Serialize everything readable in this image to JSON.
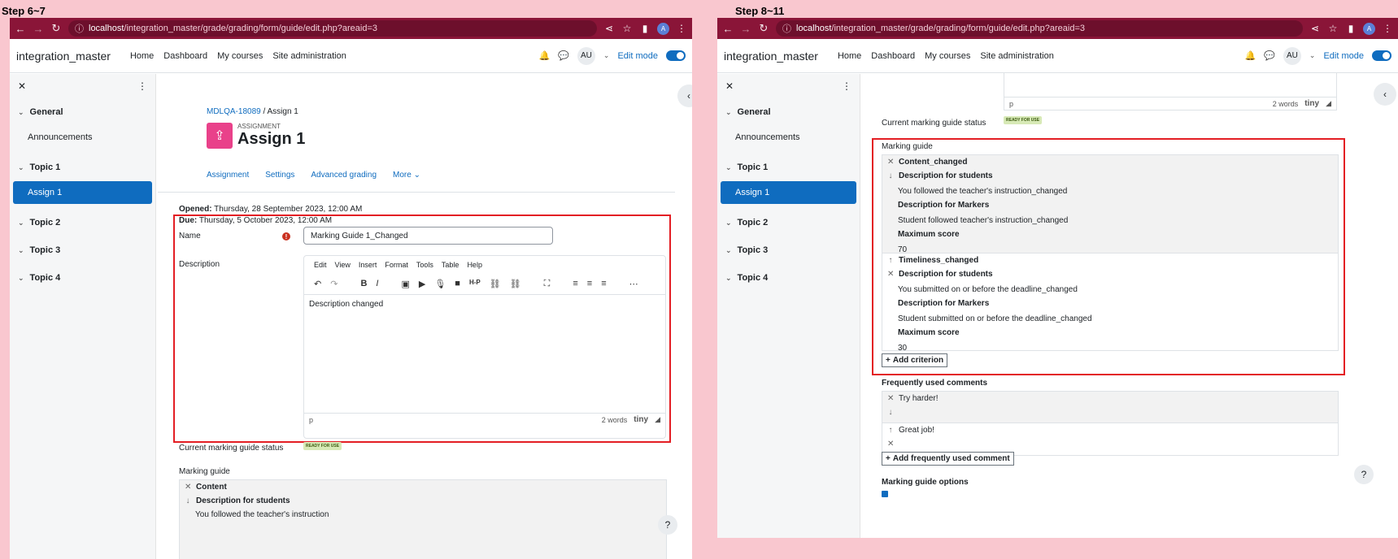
{
  "labels": {
    "step_a": "Step 6~7",
    "step_b": "Step 8~11"
  },
  "browser": {
    "url_host": "localhost",
    "url_path": "/integration_master/grade/grading/form/guide/edit.php?areaid=3",
    "profile_initial": "A"
  },
  "site": {
    "brand": "integration_master",
    "nav": [
      "Home",
      "Dashboard",
      "My courses",
      "Site administration"
    ],
    "user_initials": "AU",
    "edit_mode": "Edit mode"
  },
  "drawer": {
    "sections": [
      {
        "label": "General",
        "items": [
          "Announcements"
        ]
      },
      {
        "label": "Topic 1",
        "items": [
          "Assign 1"
        ]
      },
      {
        "label": "Topic 2",
        "items": []
      },
      {
        "label": "Topic 3",
        "items": []
      },
      {
        "label": "Topic 4",
        "items": []
      }
    ]
  },
  "page": {
    "breadcrumb": [
      "MDLQA-18089",
      "Assign 1"
    ],
    "module_label": "ASSIGNMENT",
    "title": "Assign 1",
    "tabs": [
      "Assignment",
      "Settings",
      "Advanced grading",
      "More"
    ],
    "opened_label": "Opened:",
    "opened_value": "Thursday, 28 September 2023, 12:00 AM",
    "due_label": "Due:",
    "due_value": "Thursday, 5 October 2023, 12:00 AM"
  },
  "form": {
    "name_label": "Name",
    "name_value": "Marking Guide 1_Changed",
    "description_label": "Description",
    "editor_menu": [
      "Edit",
      "View",
      "Insert",
      "Format",
      "Tools",
      "Table",
      "Help"
    ],
    "editor_content": "Description changed",
    "editor_path": "p",
    "word_count": "2 words",
    "tiny_brand": "tiny",
    "status_label": "Current marking guide status",
    "status_badge": "READY FOR USE",
    "marking_guide_label": "Marking guide"
  },
  "criteria_a": [
    {
      "name": "Content",
      "students_heading": "Description for students",
      "students_text": "You followed the teacher's instruction"
    }
  ],
  "criteria_b": [
    {
      "name": "Content_changed",
      "students_heading": "Description for students",
      "students_text": "You followed the teacher's instruction_changed",
      "markers_heading": "Description for Markers",
      "markers_text": "Student followed teacher's instruction_changed",
      "score_heading": "Maximum score",
      "score": "70"
    },
    {
      "name": "Timeliness_changed",
      "students_heading": "Description for students",
      "students_text": "You submitted on or before the deadline_changed",
      "markers_heading": "Description for Markers",
      "markers_text": "Student submitted on or before the deadline_changed",
      "score_heading": "Maximum score",
      "score": "30"
    }
  ],
  "buttons": {
    "add_criterion": "Add criterion",
    "add_comment": "Add frequently used comment"
  },
  "comments": {
    "heading": "Frequently used comments",
    "items": [
      "Try harder!",
      "Great job!"
    ]
  },
  "options": {
    "heading": "Marking guide options"
  }
}
